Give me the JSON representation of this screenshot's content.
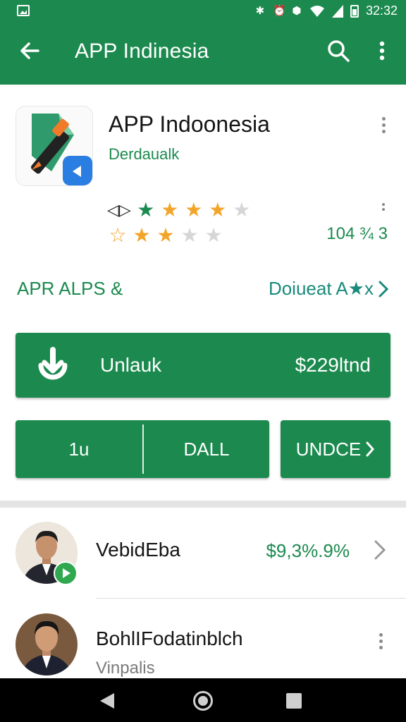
{
  "status_bar": {
    "time": "32:32"
  },
  "app_bar": {
    "title": "APP Indinesia"
  },
  "app": {
    "name": "APP Indoonesia",
    "developer": "Derdaualk",
    "rating_lead": "◁▷",
    "review_count": "104 ¾ 3"
  },
  "section": {
    "left_label": "APR ALPS &",
    "right_link": "Doiueat A★x"
  },
  "install": {
    "label": "Unlauk",
    "price": "$229ltnd"
  },
  "buttons": {
    "split_left": "1u",
    "split_right": "DALL",
    "more": "UNDCE"
  },
  "list": [
    {
      "name": "VebidEba",
      "price": "$9,3%.9%"
    },
    {
      "name": "BohlIFodatinblch",
      "subtitle": "Vinpalis"
    }
  ],
  "colors": {
    "primary": "#1c8a4f",
    "star": "#f3a52b",
    "link": "#1a8a7a"
  }
}
